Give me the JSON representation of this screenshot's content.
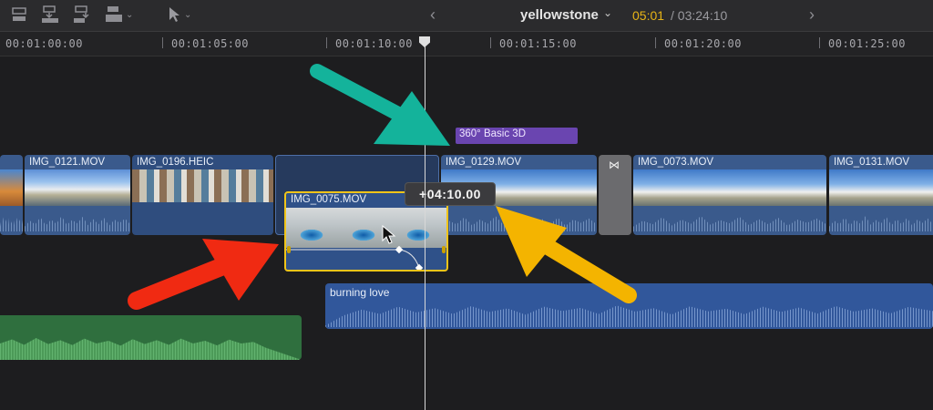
{
  "toolbar": {
    "buttons": [
      {
        "name": "connect-clip-icon"
      },
      {
        "name": "insert-clip-icon"
      },
      {
        "name": "append-clip-icon"
      },
      {
        "name": "overwrite-clip-icon"
      }
    ],
    "select_tool_icon": "arrow-pointer-icon"
  },
  "project": {
    "title": "yellowstone",
    "timecode_current": "05:01",
    "timecode_total": "/ 03:24:10"
  },
  "ruler": {
    "labels": [
      "00:01:00:00",
      "00:01:05:00",
      "00:01:10:00",
      "00:01:15:00",
      "00:01:20:00",
      "00:01:25:00"
    ]
  },
  "timeline": {
    "effect_label": "360° Basic 3D",
    "clips": {
      "c0121": "IMG_0121.MOV",
      "c0196": "IMG_0196.HEIC",
      "c0129": "IMG_0129.MOV",
      "c0073": "IMG_0073.MOV",
      "c0131": "IMG_0131.MOV"
    },
    "dragged_clip": "IMG_0075.MOV",
    "drag_offset": "+04:10.00",
    "audio_clip": "burning love"
  },
  "colors": {
    "teal_arrow": "#14b39b",
    "red_arrow": "#f02a12",
    "yellow_arrow": "#f4b400",
    "selection": "#f0c419"
  }
}
